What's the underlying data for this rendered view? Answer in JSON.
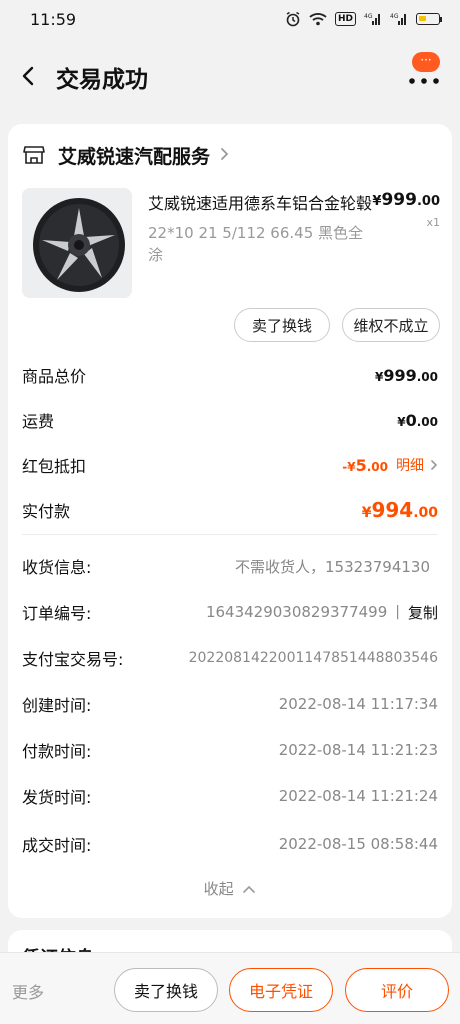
{
  "status_bar": {
    "time": "11:59",
    "icons": [
      "alarm-icon",
      "wifi-icon",
      "hd-icon",
      "signal-4g-icon",
      "signal-4g-icon",
      "battery-icon"
    ],
    "hd_label": "HD",
    "net_label_1": "4G",
    "net_label_2": "4G"
  },
  "nav": {
    "title": "交易成功",
    "back_icon": "chevron-left-icon",
    "more_icon": "more-dots-icon",
    "badge_text": "···"
  },
  "shop": {
    "name": "艾威锐速汽配服务",
    "icon": "store-icon"
  },
  "product": {
    "title": "艾威锐速适用德系车铝合金轮毂",
    "spec": "22*10 21 5/112 66.45 黑色全涂",
    "price_currency": "¥",
    "price_int": "999",
    "price_dec": ".00",
    "qty": "x1"
  },
  "actions": {
    "sell_label": "卖了换钱",
    "claim_label": "维权不成立"
  },
  "summary": {
    "total_label": "商品总价",
    "total_cur": "¥",
    "total_int": "999",
    "total_dec": ".00",
    "shipping_label": "运费",
    "shipping_cur": "¥",
    "shipping_int": "0",
    "shipping_dec": ".00",
    "redpacket_label": "红包抵扣",
    "redpacket_prefix": "-¥",
    "redpacket_int": "5",
    "redpacket_dec": ".00",
    "redpacket_detail": "明细",
    "paid_label": "实付款",
    "paid_cur": "¥",
    "paid_int": "994",
    "paid_dec": ".00"
  },
  "info": {
    "receiver_label": "收货信息:",
    "receiver_value": "不需收货人，15323794130",
    "order_label": "订单编号:",
    "order_value": "1643429030829377499",
    "copy_sep": "|",
    "copy_label": "复制",
    "alipay_label": "支付宝交易号:",
    "alipay_value": "2022081422001147851448803546",
    "created_label": "创建时间:",
    "created_value": "2022-08-14 11:17:34",
    "paid_time_label": "付款时间:",
    "paid_time_value": "2022-08-14 11:21:23",
    "shipped_label": "发货时间:",
    "shipped_value": "2022-08-14 11:21:24",
    "deal_label": "成交时间:",
    "deal_value": "2022-08-15 08:58:44",
    "collapse_label": "收起"
  },
  "voucher_section": {
    "title": "凭证信息"
  },
  "bottom_bar": {
    "more": "更多",
    "sell": "卖了换钱",
    "voucher": "电子凭证",
    "review": "评价"
  },
  "colors": {
    "accent": "#ff5000",
    "page_bg": "#f2f2f2",
    "card_bg": "#ffffff"
  }
}
